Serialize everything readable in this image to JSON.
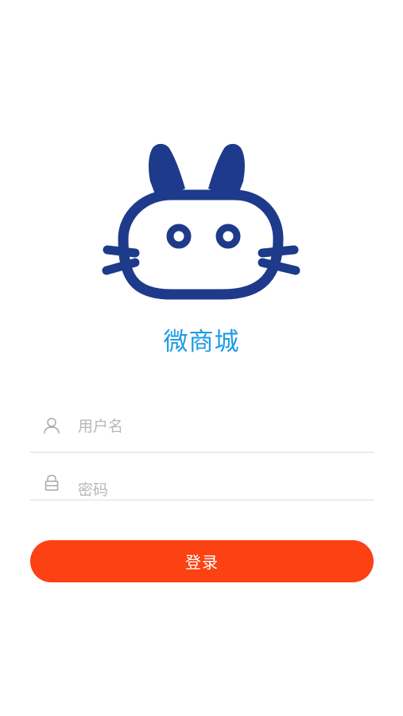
{
  "app": {
    "title": "微商城"
  },
  "logo": {
    "icon": "cat-mascot-logo-icon"
  },
  "form": {
    "username": {
      "value": "",
      "placeholder": "用户名",
      "icon": "user-icon"
    },
    "password": {
      "value": "",
      "placeholder": "密码",
      "icon": "lock-icon"
    },
    "login_label": "登录"
  },
  "colors": {
    "logo": "#1e3a8a",
    "title": "#1a9be6",
    "button": "#fc4112",
    "button_text": "#ffffff",
    "divider": "#dcdcdc",
    "icon": "#a8a8a8",
    "placeholder": "#b8b8b8"
  }
}
